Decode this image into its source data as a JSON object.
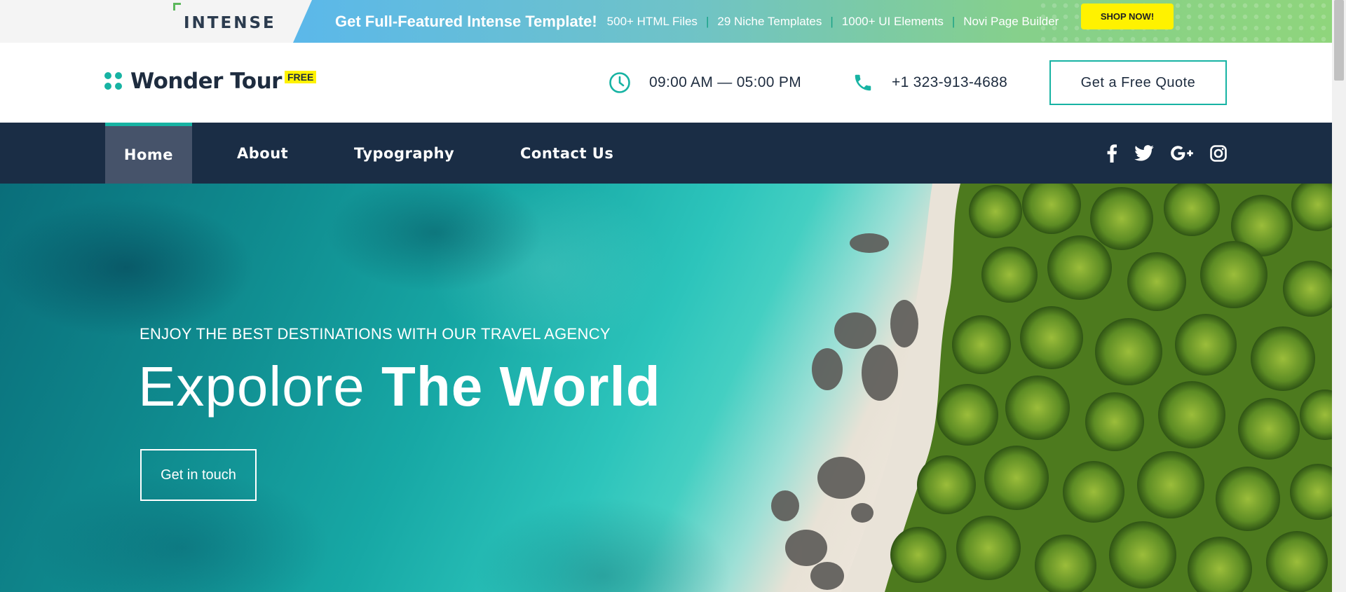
{
  "promo": {
    "logo": "INTENSE",
    "title": "Get Full-Featured Intense Template!",
    "features": [
      "500+ HTML Files",
      "29 Niche Templates",
      "1000+ UI Elements",
      "Novi Page Builder"
    ],
    "shop_label": "SHOP NOW!"
  },
  "header": {
    "brand_name": "Wonder Tour",
    "brand_badge": "FREE",
    "hours_icon": "clock-icon",
    "hours": "09:00 AM — 05:00 PM",
    "phone_icon": "phone-icon",
    "phone": "+1 323-913-4688",
    "quote_label": "Get a Free Quote"
  },
  "nav": {
    "items": [
      {
        "label": "Home",
        "active": true
      },
      {
        "label": "About",
        "active": false
      },
      {
        "label": "Typography",
        "active": false
      },
      {
        "label": "Contact Us",
        "active": false
      }
    ],
    "social": [
      "facebook-icon",
      "twitter-icon",
      "google-plus-icon",
      "instagram-icon"
    ]
  },
  "hero": {
    "tagline": "ENJOY THE BEST DESTINATIONS WITH OUR TRAVEL AGENCY",
    "title_light": "Expolore",
    "title_bold": "The World",
    "cta_label": "Get in touch"
  },
  "colors": {
    "accent": "#17b3a3",
    "navy": "#1a2d45",
    "nav_active": "#46536a",
    "badge": "#fff200"
  }
}
